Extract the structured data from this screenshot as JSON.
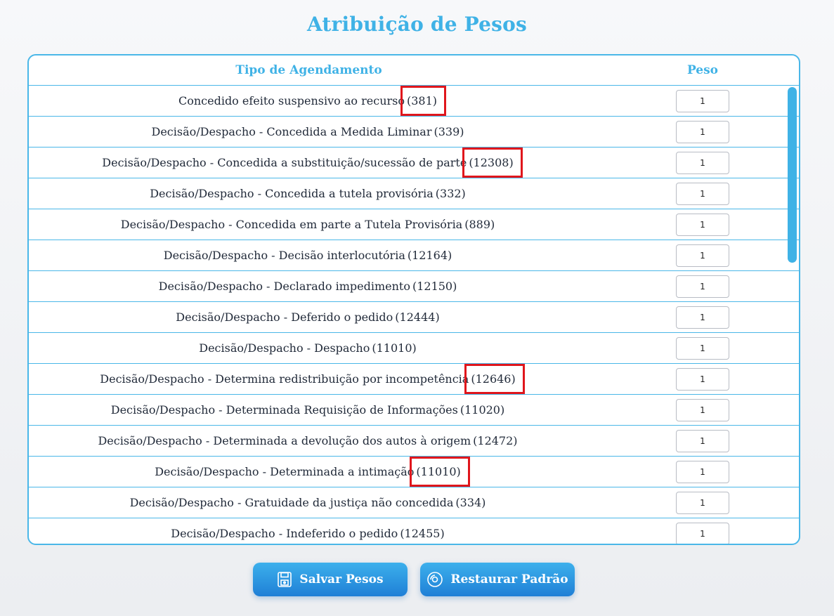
{
  "page": {
    "title": "Atribuição de Pesos"
  },
  "table": {
    "headers": {
      "type": "Tipo de Agendamento",
      "weight": "Peso"
    },
    "rows": [
      {
        "label": "Concedido efeito suspensivo ao recurso",
        "code": "(381)",
        "weight": "1",
        "highlighted": true
      },
      {
        "label": "Decisão/Despacho - Concedida a Medida Liminar",
        "code": "(339)",
        "weight": "1",
        "highlighted": false
      },
      {
        "label": "Decisão/Despacho - Concedida a substituição/sucessão de parte",
        "code": "(12308)",
        "weight": "1",
        "highlighted": true
      },
      {
        "label": "Decisão/Despacho - Concedida a tutela provisória",
        "code": "(332)",
        "weight": "1",
        "highlighted": false
      },
      {
        "label": "Decisão/Despacho - Concedida em parte a Tutela Provisória",
        "code": "(889)",
        "weight": "1",
        "highlighted": false
      },
      {
        "label": "Decisão/Despacho - Decisão interlocutória",
        "code": "(12164)",
        "weight": "1",
        "highlighted": false
      },
      {
        "label": "Decisão/Despacho - Declarado impedimento",
        "code": "(12150)",
        "weight": "1",
        "highlighted": false
      },
      {
        "label": "Decisão/Despacho - Deferido o pedido",
        "code": "(12444)",
        "weight": "1",
        "highlighted": false
      },
      {
        "label": "Decisão/Despacho - Despacho",
        "code": "(11010)",
        "weight": "1",
        "highlighted": false
      },
      {
        "label": "Decisão/Despacho - Determina redistribuição por incompetência",
        "code": "(12646)",
        "weight": "1",
        "highlighted": true
      },
      {
        "label": "Decisão/Despacho - Determinada Requisição de Informações",
        "code": "(11020)",
        "weight": "1",
        "highlighted": false
      },
      {
        "label": "Decisão/Despacho - Determinada a devolução dos autos à origem",
        "code": "(12472)",
        "weight": "1",
        "highlighted": false
      },
      {
        "label": "Decisão/Despacho - Determinada a intimação",
        "code": "(11010)",
        "weight": "1",
        "highlighted": true
      },
      {
        "label": "Decisão/Despacho - Gratuidade da justiça não concedida",
        "code": "(334)",
        "weight": "1",
        "highlighted": false
      },
      {
        "label": "Decisão/Despacho - Indeferido o pedido",
        "code": "(12455)",
        "weight": "1",
        "highlighted": false
      }
    ]
  },
  "actions": {
    "save_label": "Salvar Pesos",
    "save_icon": "floppy-disk-icon",
    "restore_label": "Restaurar Padrão",
    "restore_icon": "restore-disc-icon"
  },
  "colors": {
    "accent": "#3fb2e6",
    "highlight_box": "#e0161c",
    "button_gradient_top": "#3cb0ec",
    "button_gradient_bottom": "#1f7fd6"
  }
}
